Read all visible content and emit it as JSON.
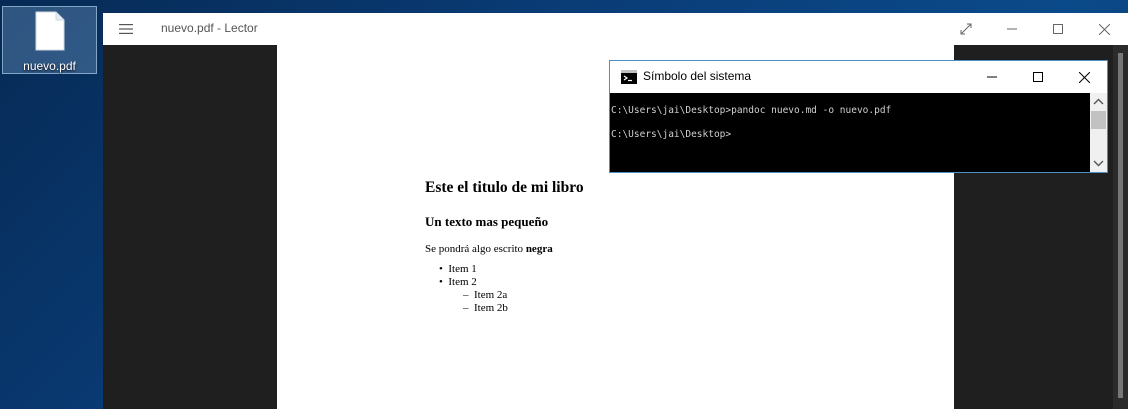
{
  "desktop": {
    "icon_label": "nuevo.pdf"
  },
  "lector": {
    "title": "nuevo.pdf - Lector",
    "document": {
      "heading1": "Este el titulo de mi libro",
      "heading2": "Un texto mas pequeño",
      "paragraph_prefix": "Se pondrá algo escrito ",
      "paragraph_bold": "negra",
      "items": [
        {
          "bullet": "•",
          "text": "Item 1"
        },
        {
          "bullet": "•",
          "text": "Item 2"
        },
        {
          "bullet": "–",
          "text": "Item 2a"
        },
        {
          "bullet": "–",
          "text": "Item 2b"
        }
      ]
    }
  },
  "cmd": {
    "title": "Símbolo del sistema",
    "lines": [
      "C:\\Users\\jai\\Desktop>pandoc nuevo.md -o nuevo.pdf",
      "C:\\Users\\jai\\Desktop>"
    ]
  },
  "colors": {
    "accent_border": "#4a90c8",
    "reader_background": "#1f1f1f",
    "console_background": "#000000"
  }
}
